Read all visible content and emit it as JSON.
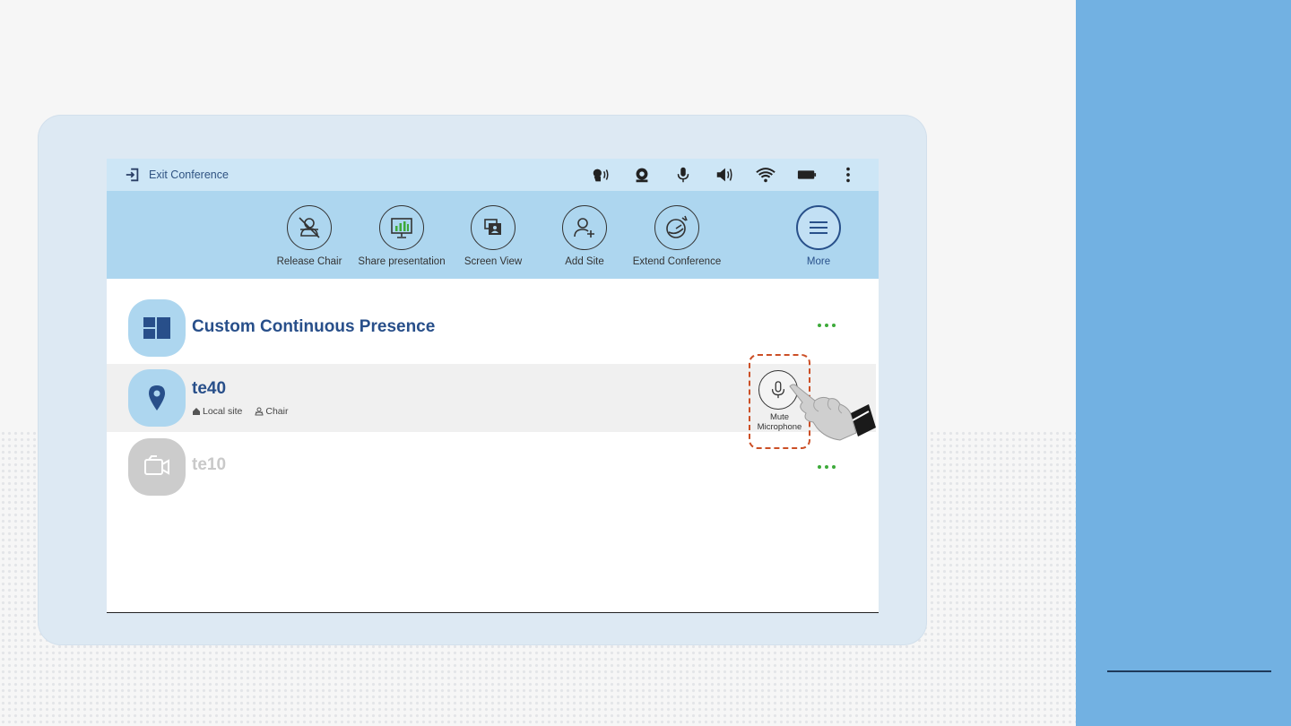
{
  "status_bar": {
    "exit_label": "Exit Conference",
    "icons": [
      "speaker-voice-icon",
      "camera-icon",
      "microphone-icon",
      "volume-icon",
      "wifi-icon",
      "battery-icon",
      "more-vertical-icon"
    ]
  },
  "toolbar": {
    "items": [
      {
        "label": "Release Chair",
        "icon": "release-chair-icon"
      },
      {
        "label": "Share presentation",
        "icon": "share-presentation-icon"
      },
      {
        "label": "Screen View",
        "icon": "screen-view-icon"
      },
      {
        "label": "Add Site",
        "icon": "add-site-icon"
      },
      {
        "label": "Extend Conference",
        "icon": "extend-conference-icon"
      },
      {
        "label": "More",
        "icon": "menu-icon"
      }
    ]
  },
  "sites": [
    {
      "name": "Custom Continuous Presence",
      "icon": "layout-grid-icon"
    },
    {
      "name": "te40",
      "icon": "location-pin-icon",
      "tags": [
        "Local site",
        "Chair"
      ]
    },
    {
      "name": "te10",
      "icon": "video-camera-icon"
    }
  ],
  "mute_action": {
    "line1": "Mute",
    "line2": "Microphone"
  },
  "colors": {
    "accent": "#284f8a",
    "status_bar": "#cde6f6",
    "toolbar": "#add6ef",
    "highlight_box": "#cc4f26",
    "dots": "#3daa3a",
    "right_panel": "#72b1e2"
  }
}
